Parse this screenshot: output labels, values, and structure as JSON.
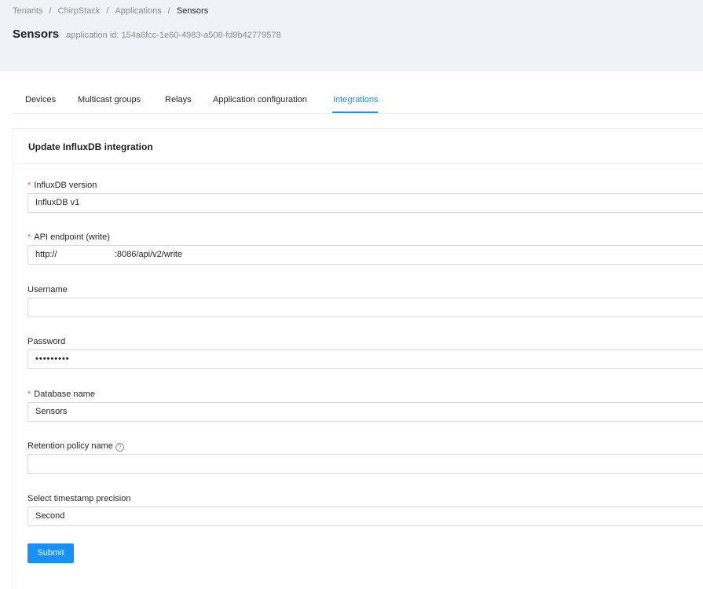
{
  "breadcrumb": {
    "items": [
      "Tenants",
      "ChirpStack",
      "Applications",
      "Sensors"
    ],
    "separator": "/"
  },
  "header": {
    "title": "Sensors",
    "subtitle": "application id: 154a6fcc-1e60-4983-a508-fd9b42779578"
  },
  "tabs": [
    {
      "label": "Devices"
    },
    {
      "label": "Multicast groups"
    },
    {
      "label": "Relays"
    },
    {
      "label": "Application configuration"
    },
    {
      "label": "Integrations",
      "active": true
    }
  ],
  "card": {
    "title": "Update InfluxDB integration"
  },
  "form": {
    "required_mark": "*",
    "influxdb_version": {
      "label": "InfluxDB version",
      "value": "InfluxDB v1",
      "required": true
    },
    "api_endpoint": {
      "label": "API endpoint (write)",
      "value": "http://                        :8086/api/v2/write",
      "required": true
    },
    "username": {
      "label": "Username",
      "value": ""
    },
    "password": {
      "label": "Password",
      "value": "•••••••••"
    },
    "database_name": {
      "label": "Database name",
      "value": "Sensors",
      "required": true
    },
    "retention_policy": {
      "label": "Retention policy name",
      "value": "",
      "help_icon": "question-circle-icon",
      "help_glyph": "?"
    },
    "timestamp_precision": {
      "label": "Select timestamp precision",
      "value": "Second"
    },
    "submit_label": "Submit"
  },
  "colors": {
    "primary": "#1890ff",
    "required": "#ff4d4f",
    "header_bg": "#f0f2f5"
  }
}
